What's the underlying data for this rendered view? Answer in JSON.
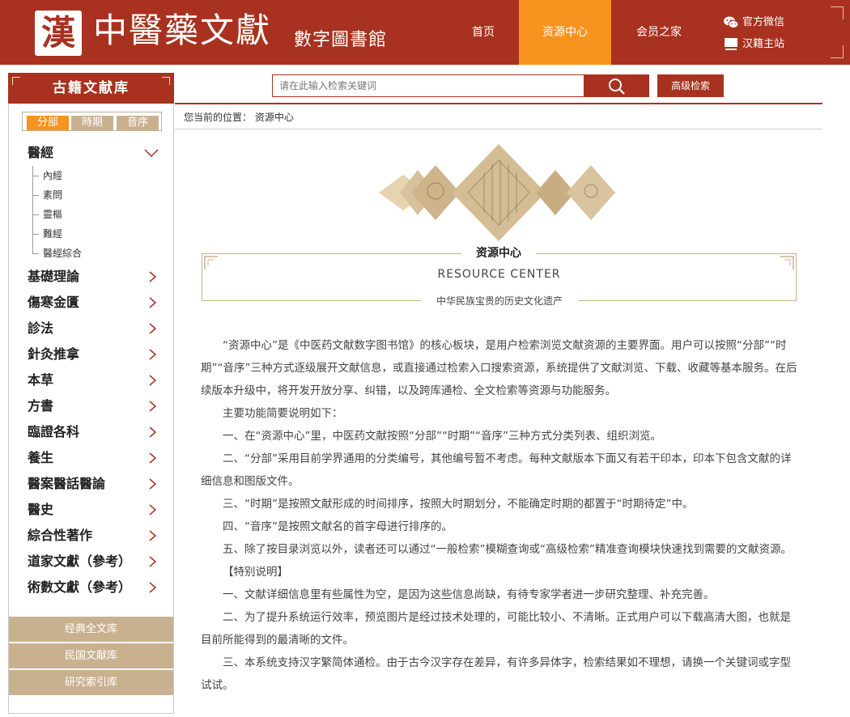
{
  "header": {
    "logo_seal": "漢",
    "logo_title": "中醫藥文獻",
    "logo_subtitle": "數字圖書館",
    "nav": [
      {
        "label": "首页"
      },
      {
        "label": "资源中心"
      },
      {
        "label": "会员之家"
      }
    ],
    "links": {
      "wechat": "官方微信",
      "site": "汉籍主站"
    },
    "accent_color": "#a8321f",
    "active_color": "#f7931e"
  },
  "sidebar": {
    "title": "古籍文献库",
    "tabs": [
      {
        "label": "分部",
        "active": true
      },
      {
        "label": "時期",
        "active": false
      },
      {
        "label": "音序",
        "active": false
      }
    ],
    "expanded": {
      "label": "醫經",
      "children": [
        "內經",
        "素問",
        "靈樞",
        "難經",
        "醫經綜合"
      ]
    },
    "categories": [
      "基礎理論",
      "傷寒金匱",
      "診法",
      "針灸推拿",
      "本草",
      "方書",
      "臨證各科",
      "養生",
      "醫案醫話醫論",
      "醫史",
      "綜合性著作",
      "道家文獻（參考）",
      "術數文獻（參考）"
    ],
    "libraries": [
      "经典全文库",
      "民国文献库",
      "研究索引库"
    ]
  },
  "search": {
    "placeholder": "请在此输入检索关键词",
    "advanced_label": "高级检索"
  },
  "breadcrumb": {
    "prefix": "您当前的位置：",
    "current": "资源中心"
  },
  "banner": {
    "title": "资源中心",
    "subtitle_en": "RESOURCE CENTER",
    "tagline": "中华民族宝贵的历史文化遗产"
  },
  "article": {
    "paragraphs": [
      "“资源中心”是《中医药文献数字图书馆》的核心板块，是用户检索浏览文献资源的主要界面。用户可以按照“分部”“时期”“音序”三种方式逐级展开文献信息，或直接通过检索入口搜索资源，系统提供了文献浏览、下载、收藏等基本服务。在后续版本升级中，将开发开放分享、纠错，以及跨库通检、全文检索等资源与功能服务。",
      "主要功能简要说明如下：",
      "一、在“资源中心”里，中医药文献按照“分部”“时期”“音序”三种方式分类列表、组织浏览。",
      "二、“分部”采用目前学界通用的分类编号，其他编号暂不考虑。每种文献版本下面又有若干印本，印本下包含文献的详细信息和图版文件。",
      "三、“时期”是按照文献形成的时间排序，按照大时期划分，不能确定时期的都置于“时期待定”中。",
      "四、“音序”是按照文献名的首字母进行排序的。",
      "五、除了按目录浏览以外，读者还可以通过“一般检索”模糊查询或“高级检索”精准查询模块快速找到需要的文献资源。",
      "【特别说明】",
      "一、文献详细信息里有些属性为空，是因为这些信息尚缺，有待专家学者进一步研究整理、补充完善。",
      "二、为了提升系统运行效率，预览图片是经过技术处理的，可能比较小、不清晰。正式用户可以下载高清大图，也就是目前所能得到的最清晰的文件。",
      "三、本系统支持汉字繁简体通检。由于古今汉字存在差异，有许多异体字，检索结果如不理想，请换一个关键词或字型试试。"
    ]
  }
}
